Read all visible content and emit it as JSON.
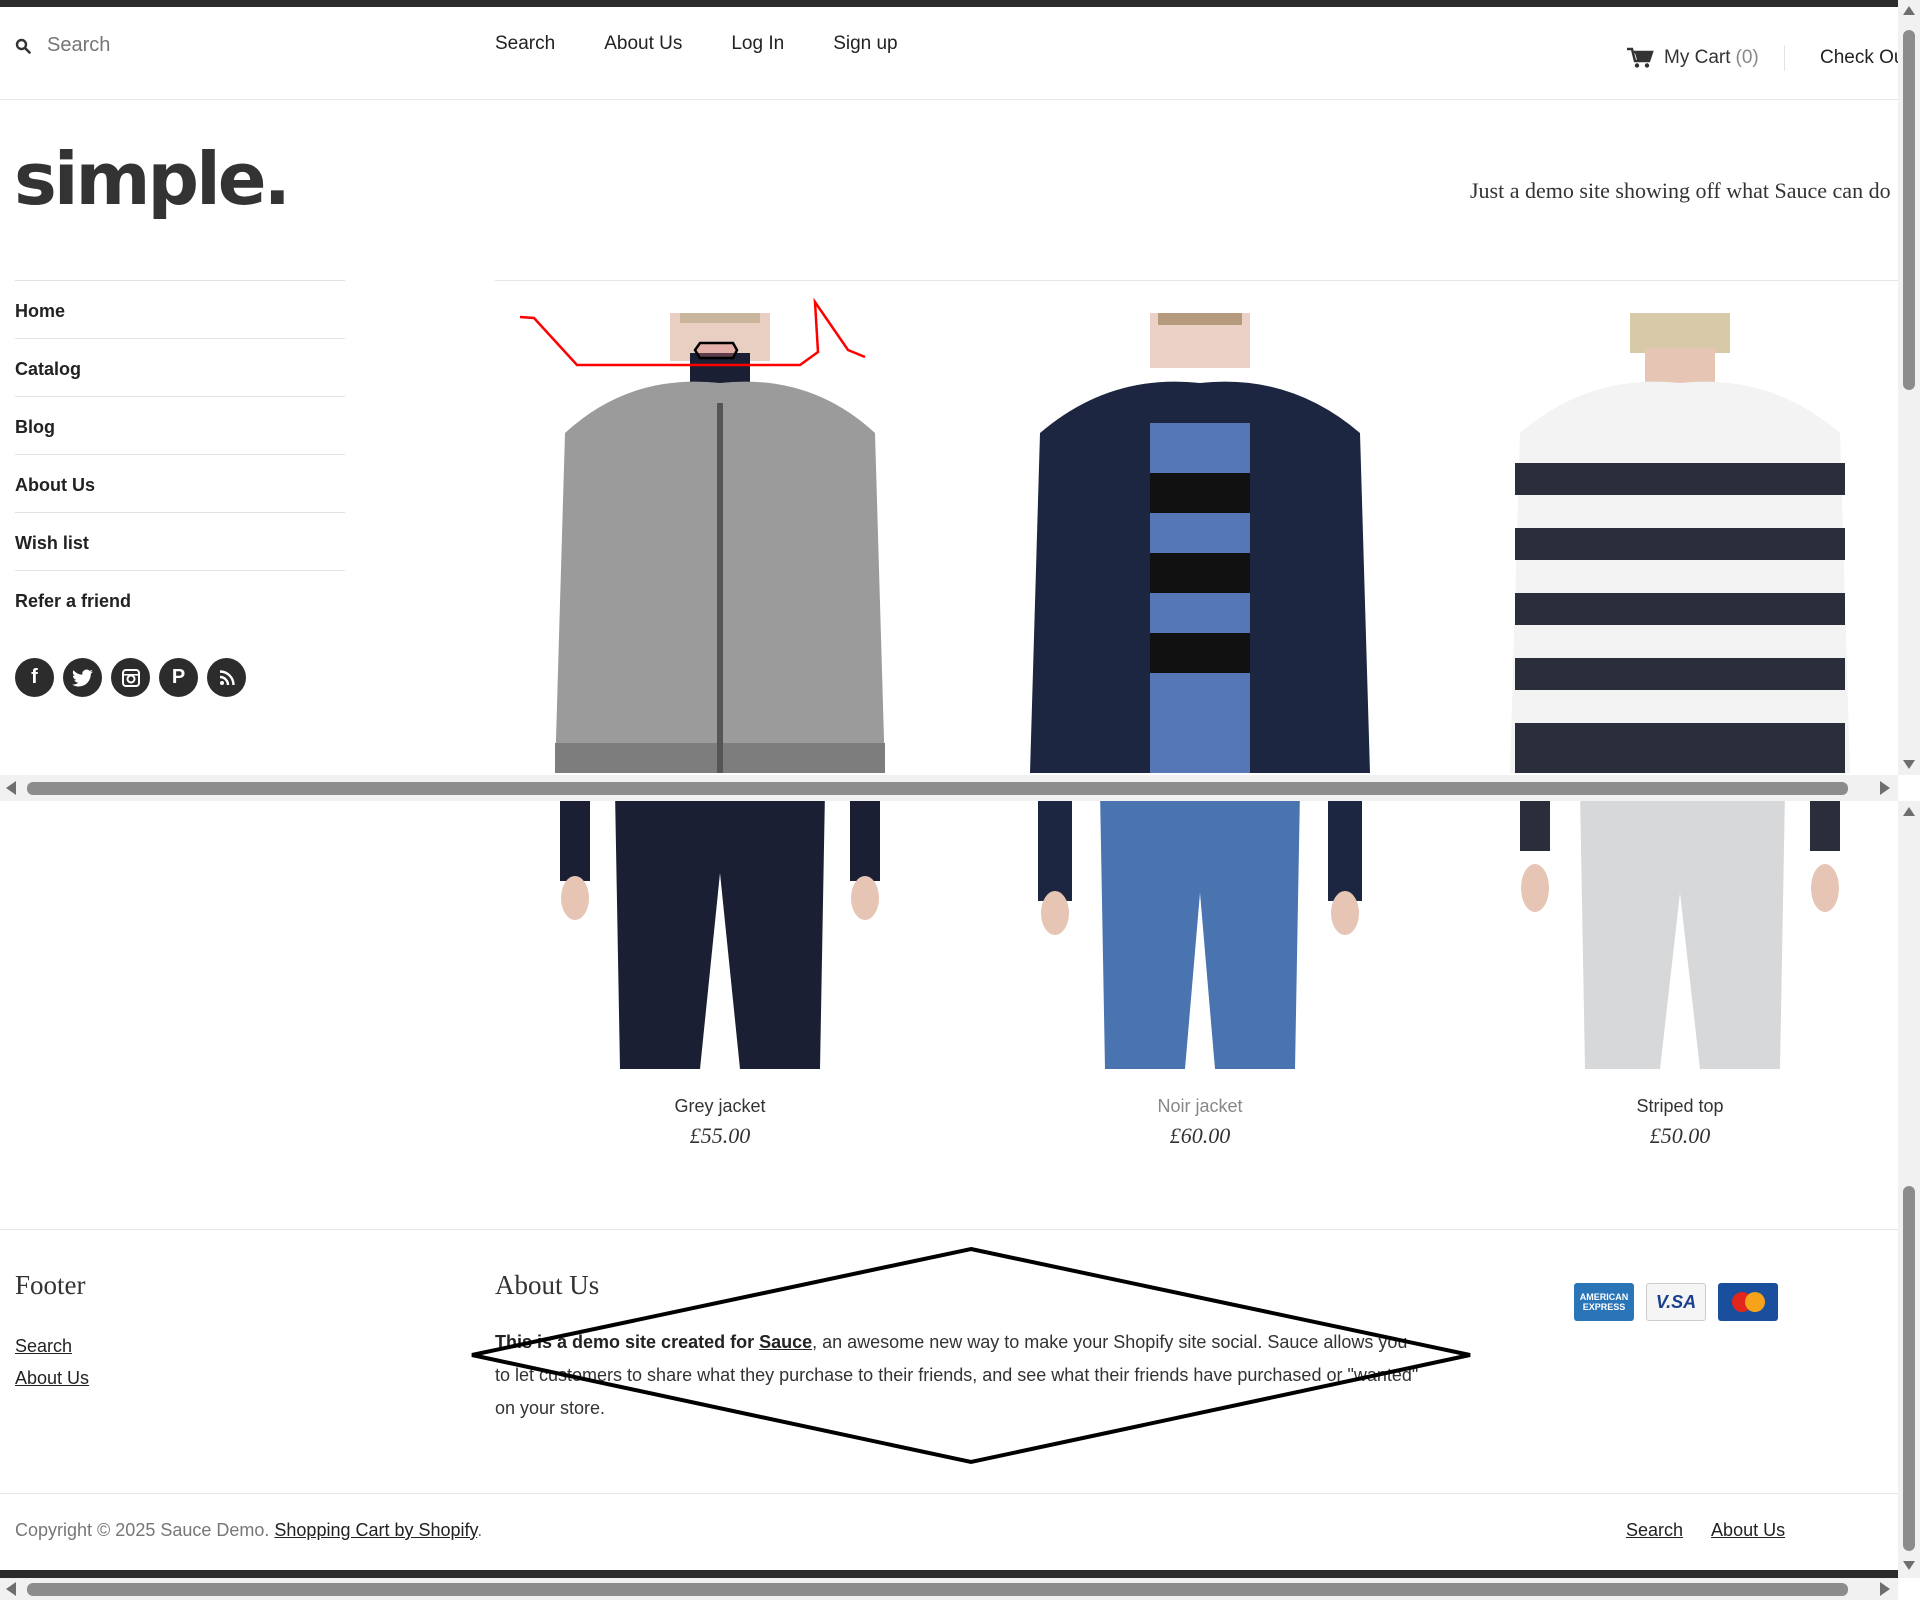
{
  "header": {
    "search_placeholder": "Search",
    "nav": [
      "Search",
      "About Us",
      "Log In",
      "Sign up"
    ],
    "cart_label": "My Cart",
    "cart_count": "(0)",
    "checkout_label": "Check Out"
  },
  "brand": {
    "logo": "simple.",
    "tagline": "Just a demo site showing off what Sauce can do"
  },
  "sidebar": {
    "items": [
      "Home",
      "Catalog",
      "Blog",
      "About Us",
      "Wish list",
      "Refer a friend"
    ],
    "social_icons": [
      "facebook-icon",
      "twitter-icon",
      "instagram-icon",
      "pinterest-icon",
      "rss-icon"
    ]
  },
  "products": [
    {
      "name": "Grey jacket",
      "price": "£55.00"
    },
    {
      "name": "Noir jacket",
      "price": "£60.00"
    },
    {
      "name": "Striped top",
      "price": "£50.00"
    }
  ],
  "footer": {
    "title": "Footer",
    "links": [
      "Search",
      "About Us"
    ],
    "about_title": "About Us",
    "about_bold": "This is a demo site created for ",
    "about_link": "Sauce",
    "about_rest": ", an awesome new way to make your Shopify site social. Sauce allows you to let customers to share what they purchase to their friends, and see what their friends have purchased or \"wanted\" on your store.",
    "payment_cards": [
      "American Express",
      "VISA",
      "MasterCard"
    ]
  },
  "bottom": {
    "copyright": "Copyright © 2025 Sauce Demo. ",
    "shopify_link": "Shopping Cart by Shopify",
    "period": ".",
    "links": [
      "Search",
      "About Us"
    ]
  },
  "colors": {
    "bar": "#2c2c2c",
    "text": "#333333",
    "muted": "#888888",
    "annotation_red": "#ff0000",
    "annotation_black": "#000000"
  }
}
